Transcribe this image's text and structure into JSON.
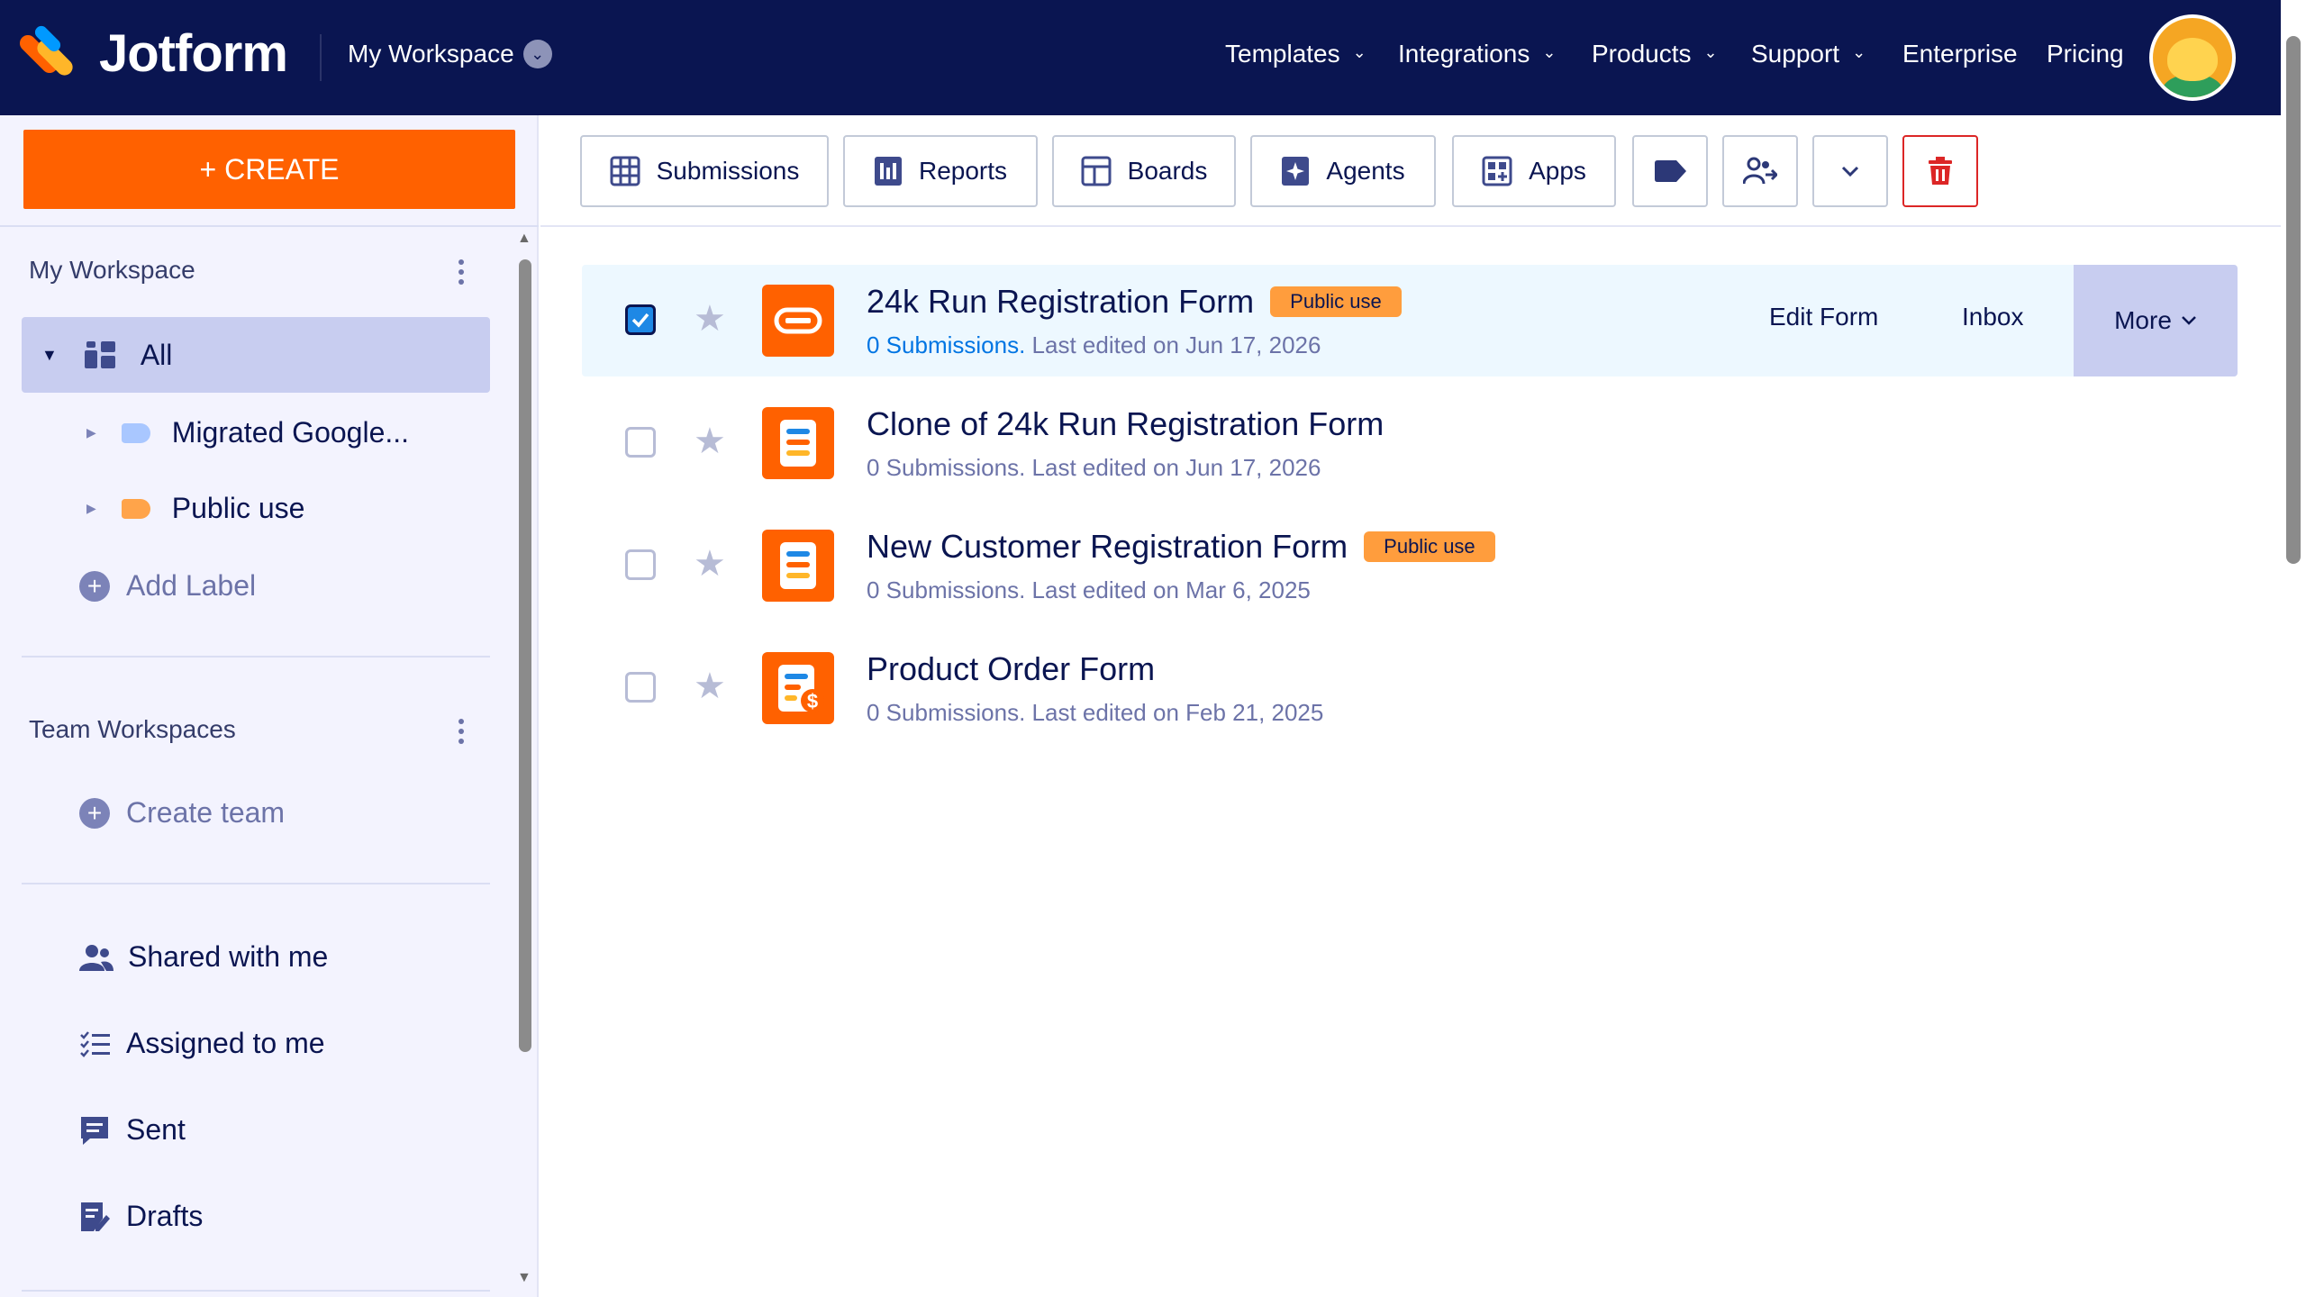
{
  "header": {
    "brand": "Jotform",
    "workspace": "My Workspace",
    "nav": [
      {
        "label": "Templates",
        "has_menu": true
      },
      {
        "label": "Integrations",
        "has_menu": true
      },
      {
        "label": "Products",
        "has_menu": true
      },
      {
        "label": "Support",
        "has_menu": true
      },
      {
        "label": "Enterprise",
        "has_menu": false
      },
      {
        "label": "Pricing",
        "has_menu": false
      }
    ]
  },
  "sidebar": {
    "create_label": "+ CREATE",
    "my_workspace_title": "My Workspace",
    "all_label": "All",
    "labels": [
      {
        "name": "Migrated Google...",
        "color": "#a9c7ff"
      },
      {
        "name": "Public use",
        "color": "#ffa44a"
      }
    ],
    "add_label": "Add Label",
    "team_title": "Team Workspaces",
    "create_team": "Create team",
    "links": [
      {
        "label": "Shared with me",
        "icon": "shared-users-icon"
      },
      {
        "label": "Assigned to me",
        "icon": "checklist-icon"
      },
      {
        "label": "Sent",
        "icon": "message-icon"
      },
      {
        "label": "Drafts",
        "icon": "draft-icon"
      }
    ]
  },
  "toolbar": {
    "buttons": [
      "Submissions",
      "Reports",
      "Boards",
      "Agents",
      "Apps"
    ]
  },
  "forms": [
    {
      "title": "24k Run Registration Form",
      "badge": "Public use",
      "submissions": "0 Submissions.",
      "edited": "Last edited on Jun 17, 2026",
      "selected": true,
      "icon": "form-ticket-icon"
    },
    {
      "title": "Clone of 24k Run Registration Form",
      "badge": "",
      "submissions": "0 Submissions.",
      "edited": "Last edited on Jun 17, 2026",
      "selected": false,
      "icon": "form-list-icon"
    },
    {
      "title": "New Customer Registration Form",
      "badge": "Public use",
      "submissions": "0 Submissions.",
      "edited": "Last edited on Mar 6, 2025",
      "selected": false,
      "icon": "form-list-icon"
    },
    {
      "title": "Product Order Form",
      "badge": "",
      "submissions": "0 Submissions.",
      "edited": "Last edited on Feb 21, 2025",
      "selected": false,
      "icon": "form-payment-icon"
    }
  ],
  "row_actions": {
    "edit": "Edit Form",
    "inbox": "Inbox",
    "more": "More"
  }
}
